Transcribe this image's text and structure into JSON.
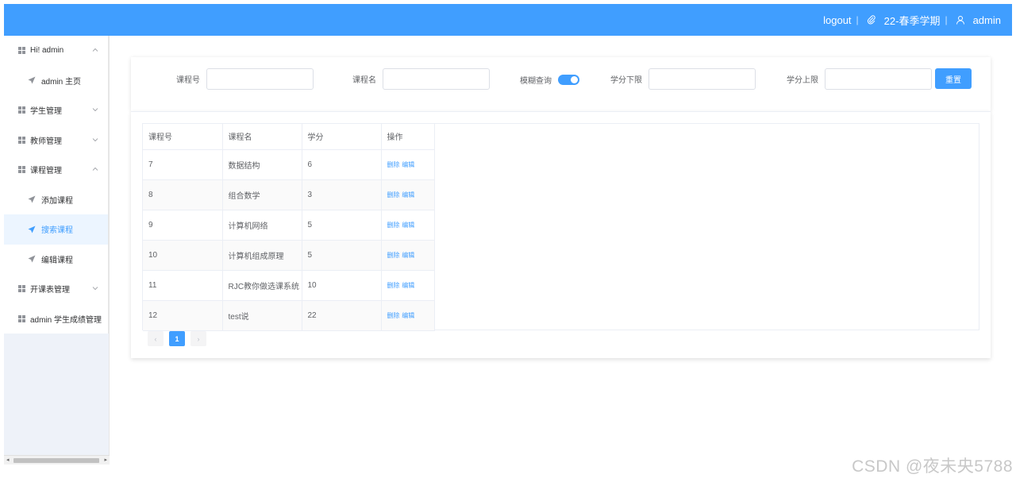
{
  "header": {
    "logout": "logout",
    "term": "22-春季学期",
    "user": "admin"
  },
  "sidebar": {
    "items": [
      {
        "label": "Hi! admin",
        "type": "top",
        "expanded": true
      },
      {
        "label": "admin 主页",
        "type": "sub"
      },
      {
        "label": "学生管理",
        "type": "top",
        "expanded": false
      },
      {
        "label": "教师管理",
        "type": "top",
        "expanded": false
      },
      {
        "label": "课程管理",
        "type": "top",
        "expanded": true
      },
      {
        "label": "添加课程",
        "type": "sub"
      },
      {
        "label": "搜索课程",
        "type": "sub",
        "active": true
      },
      {
        "label": "编辑课程",
        "type": "sub"
      },
      {
        "label": "开课表管理",
        "type": "top",
        "expanded": false
      },
      {
        "label": "admin 学生成绩管理",
        "type": "top"
      }
    ]
  },
  "search": {
    "course_id_label": "课程号",
    "course_name_label": "课程名",
    "fuzzy_label": "模糊查询",
    "fuzzy_on": true,
    "credit_min_label": "学分下限",
    "credit_max_label": "学分上限",
    "reset_label": "重置"
  },
  "table": {
    "headers": [
      "课程号",
      "课程名",
      "学分",
      "操作"
    ],
    "rows": [
      {
        "id": "7",
        "name": "数据结构",
        "credit": "6"
      },
      {
        "id": "8",
        "name": "组合数学",
        "credit": "3"
      },
      {
        "id": "9",
        "name": "计算机网络",
        "credit": "5"
      },
      {
        "id": "10",
        "name": "计算机组成原理",
        "credit": "5"
      },
      {
        "id": "11",
        "name": "RJC教你做选课系统",
        "credit": "10"
      },
      {
        "id": "12",
        "name": "test说",
        "credit": "22"
      }
    ],
    "delete_label": "删除",
    "edit_label": "编辑"
  },
  "pagination": {
    "prev": "‹",
    "current": "1",
    "next": "›"
  },
  "watermark": "CSDN @夜未央5788",
  "colors": {
    "primary": "#409eff"
  }
}
